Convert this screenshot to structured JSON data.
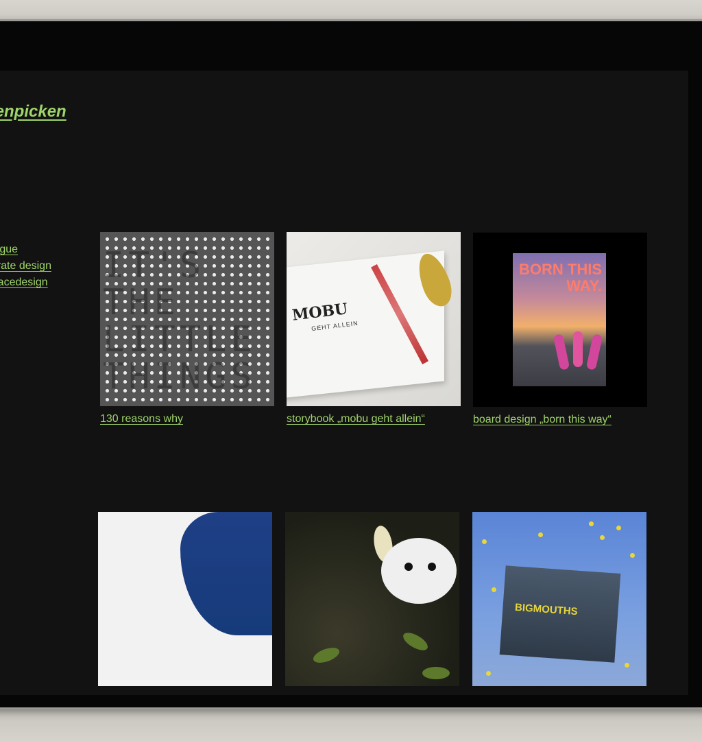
{
  "brand": {
    "title": "henpicken"
  },
  "categories": [
    {
      "label": "alogue"
    },
    {
      "label": "porate design"
    },
    {
      "label": "erfacedesign"
    }
  ],
  "projects": [
    {
      "caption": "130 reasons why"
    },
    {
      "caption": "storybook „mobu geht allein“",
      "book_title": "MOBU",
      "book_subtitle": "GEHT ALLEIN"
    },
    {
      "caption": "board design „born this way“",
      "poster_text": "BORN THIS WAY."
    },
    {
      "caption": ""
    },
    {
      "caption": ""
    },
    {
      "caption": "",
      "book_title": "BIGMOUTHS"
    }
  ],
  "colors": {
    "accent": "#9fd46a",
    "screen_bg": "#121212"
  }
}
